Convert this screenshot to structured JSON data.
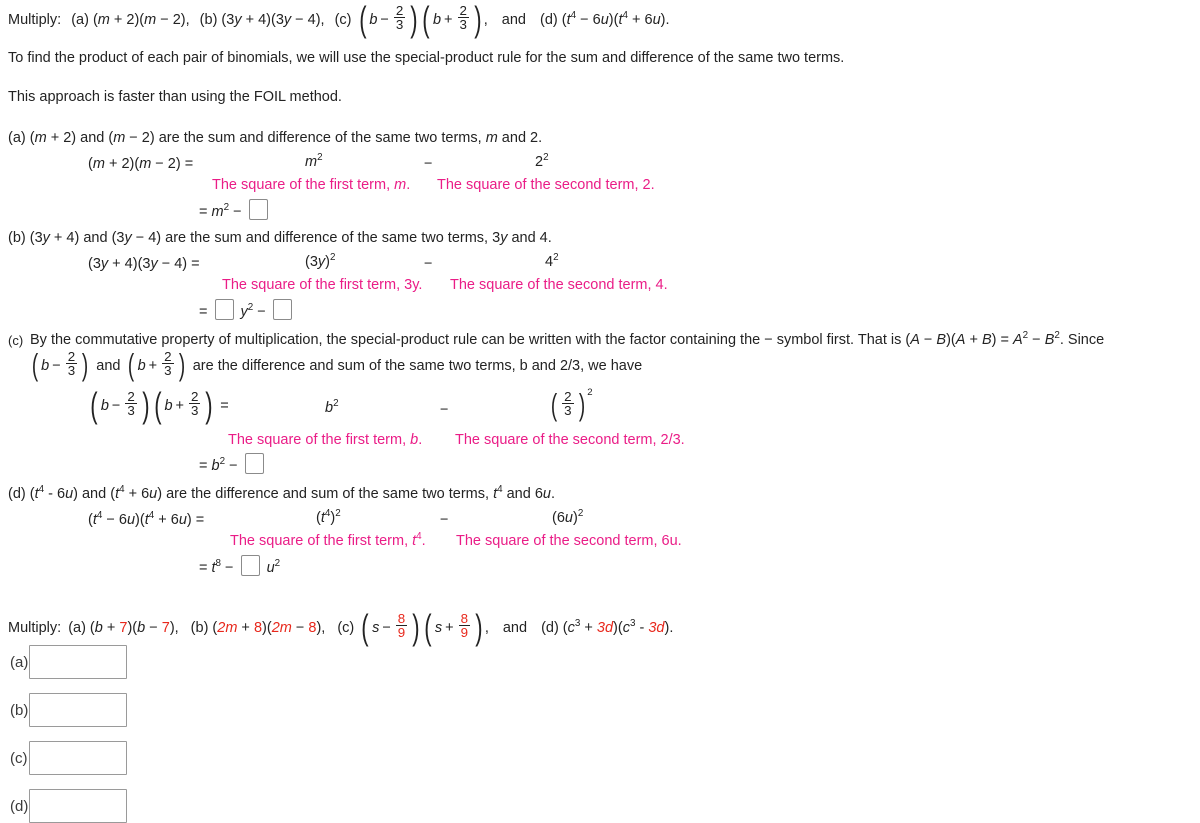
{
  "prompt": {
    "lead": "Multiply:",
    "part_a": "(a) (m + 2)(m − 2),",
    "part_b": "(b) (3y + 4)(3y − 4),",
    "part_c_label": "(c)",
    "part_c_b1": "b",
    "part_c_minus": "−",
    "part_c_num1": "2",
    "part_c_den1": "3",
    "part_c_b2": "b",
    "part_c_plus": "+",
    "part_c_num2": "2",
    "part_c_den2": "3",
    "part_c_comma": ",",
    "and": "and",
    "part_d_pre": "(d) (t",
    "part_d_exp1": "4",
    "part_d_mid": " − 6u)(t",
    "part_d_exp2": "4",
    "part_d_post": " + 6u)."
  },
  "intro": {
    "line1": "To find the product of each pair of binomials, we will use the special-product rule for the sum and difference of the same two terms.",
    "line2": "This approach is faster than using the FOIL method."
  },
  "solution_a": {
    "heading_pre": "(a) (m + 2) and (m − 2) are the sum and difference of the same two terms, ",
    "heading_var": "m",
    "heading_post": " and 2.",
    "lhs": "(m + 2)(m − 2) =",
    "term1_base": "m",
    "term1_exp": "2",
    "operator": "−",
    "term2_base": "2",
    "term2_exp": "2",
    "note1": "The square of the first term, m.",
    "note2": "The square of the second term, 2.",
    "result_eq": "=",
    "result_base": "m",
    "result_exp": "2",
    "result_minus": "−"
  },
  "solution_b": {
    "heading": "(b) (3y + 4) and (3y − 4) are the sum and difference of the same two terms, 3y and 4.",
    "lhs": "(3y + 4)(3y − 4) =",
    "term1": "(3y)",
    "term1_exp": "2",
    "operator": "−",
    "term2": "4",
    "term2_exp": "2",
    "note1": "The square of the first term, 3y.",
    "note2": "The square of the second term, 4.",
    "result_eq": "=",
    "result_var": "y",
    "result_exp": "2",
    "result_minus": "−"
  },
  "solution_c": {
    "label": "(c)",
    "heading_line1_a": "By the commutative property of multiplication, the special-product rule can be written with the factor containing the − symbol first. That is (",
    "heading_A1": "A",
    "heading_sep1": " − ",
    "heading_B1": "B",
    "heading_sep2": ")(",
    "heading_A2": "A",
    "heading_sep3": " + ",
    "heading_B2": "B",
    "heading_sep4": ") = ",
    "heading_A3": "A",
    "heading_exp1": "2",
    "heading_sep5": " − ",
    "heading_B3": "B",
    "heading_exp2": "2",
    "heading_sep6": ". Since",
    "heading_line2_and": "and",
    "heading_line2_tail": "are the difference and sum of the same two terms, b and 2/3, we have",
    "var_b": "b",
    "minus": "−",
    "plus": "+",
    "num": "2",
    "den": "3",
    "equals": "=",
    "term1_base": "b",
    "term1_exp": "2",
    "operator": "−",
    "term2_num": "2",
    "term2_den": "3",
    "term2_exp": "2",
    "note1": "The square of the first term, b.",
    "note2": "The square of the second term, 2/3.",
    "result_eq": "=",
    "result_base": "b",
    "result_exp": "2",
    "result_minus": "−"
  },
  "solution_d": {
    "label": "(d)",
    "heading_pre": "(t",
    "heading_exp1": "4",
    "heading_mid": " - 6u) and (t",
    "heading_exp2": "4",
    "heading_mid2": " + 6u) are the difference and sum of the same two terms, t",
    "heading_exp3": "4",
    "heading_post": " and 6u.",
    "lhs_pre": "(t",
    "lhs_exp1": "4",
    "lhs_mid": " − 6u)(t",
    "lhs_exp2": "4",
    "lhs_post": " + 6u) =",
    "term1_pre": "(t",
    "term1_inner_exp": "4",
    "term1_post": ")",
    "term1_exp": "2",
    "operator": "−",
    "term2": "(6u)",
    "term2_exp": "2",
    "note1": "The square of the first term, t4.",
    "note1_pre": "The square of the first term, t",
    "note1_exp": "4",
    "note1_post": ".",
    "note2": "The square of the second term, 6u.",
    "result_eq": "=",
    "result_base": "t",
    "result_exp": "8",
    "result_minus": "−",
    "result_var": "u",
    "result_var_exp": "2"
  },
  "exercise": {
    "lead": "Multiply:",
    "a_label": "(a)",
    "a_p1": "(b + ",
    "a_red1": "7",
    "a_p2": ")(b − ",
    "a_red2": "7",
    "a_p3": "),",
    "b_label": "(b)",
    "b_p1": "(",
    "b_red1": "2m",
    "b_p2": " + ",
    "b_red2": "8",
    "b_p3": ")(",
    "b_red3": "2m",
    "b_p4": " − ",
    "b_red4": "8",
    "b_p5": "),",
    "c_label": "(c)",
    "c_var": "s",
    "c_minus": "−",
    "c_plus": "+",
    "c_num": "8",
    "c_den": "9",
    "c_comma": ",",
    "and": "and",
    "d_label": "(d)",
    "d_p1": "(c",
    "d_exp1": "3",
    "d_p2": " + ",
    "d_red1": "3d",
    "d_p3": ")(c",
    "d_exp2": "3",
    "d_p4": " - ",
    "d_red2": "3d",
    "d_p5": ")."
  },
  "answers": {
    "rows": [
      {
        "label": "(a)",
        "value": ""
      },
      {
        "label": "(b)",
        "value": ""
      },
      {
        "label": "(c)",
        "value": ""
      },
      {
        "label": "(d)",
        "value": ""
      }
    ]
  },
  "colors": {
    "annotation_pink": "#ea1d87",
    "highlight_red": "#e8281c",
    "text": "#232323",
    "box_border": "#8b8b8b"
  }
}
